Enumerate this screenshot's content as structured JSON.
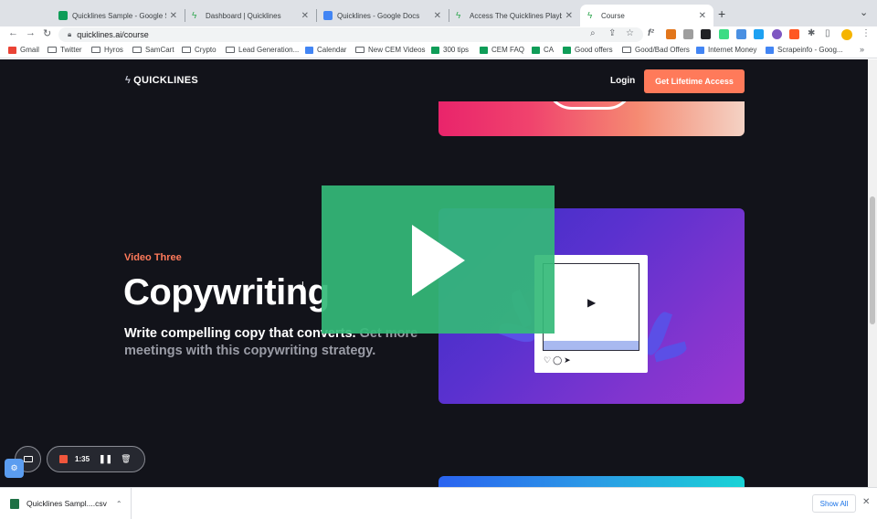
{
  "browser": {
    "tabs": [
      {
        "title": "Quicklines Sample - Google Sh",
        "favicon_color": "#0f9d58"
      },
      {
        "title": "Dashboard | Quicklines",
        "favicon_color": "#34a853"
      },
      {
        "title": "Quicklines - Google Docs",
        "favicon_color": "#4285f4"
      },
      {
        "title": "Access The Quicklines Playboo",
        "favicon_color": "#34a853"
      },
      {
        "title": "Course",
        "favicon_color": "#34a853",
        "active": true
      }
    ],
    "new_tab": "+",
    "tab_menu": "⌄",
    "url": "quicklines.ai/course",
    "bookmarks": [
      {
        "label": "Gmail",
        "icon": "gmail-icon"
      },
      {
        "label": "Twitter",
        "icon": "folder-icon"
      },
      {
        "label": "Hyros",
        "icon": "folder-icon"
      },
      {
        "label": "SamCart",
        "icon": "folder-icon"
      },
      {
        "label": "Crypto",
        "icon": "folder-icon"
      },
      {
        "label": "Lead Generation...",
        "icon": "folder-icon"
      },
      {
        "label": "Calendar",
        "icon": "calendar-icon"
      },
      {
        "label": "New CEM Videos",
        "icon": "folder-icon"
      },
      {
        "label": "300 tips",
        "icon": "sheets-icon"
      },
      {
        "label": "CEM FAQ",
        "icon": "sheets-icon"
      },
      {
        "label": "CA",
        "icon": "sheets-icon"
      },
      {
        "label": "Good offers",
        "icon": "sheets-icon"
      },
      {
        "label": "Good/Bad Offers",
        "icon": "folder-icon"
      },
      {
        "label": "Internet Money",
        "icon": "docs-icon"
      },
      {
        "label": "Scrapeinfo - Goog...",
        "icon": "docs-icon"
      }
    ],
    "bookmarks_more": "»"
  },
  "site": {
    "logo": "QUICKLINES",
    "login": "Login",
    "cta": "Get Lifetime Access",
    "eyebrow": "Video Three",
    "headline": "Copywriting",
    "sub_bright": "Write compelling copy that converts.",
    "sub_dim": " Get more meetings with this copywriting strategy."
  },
  "recorder": {
    "time": "1:35"
  },
  "downloads": {
    "file": "Quicklines Sampl....csv",
    "show_all": "Show All"
  },
  "colors": {
    "page_bg": "#12131a",
    "accent": "#ff7a5a",
    "play_overlay": "#34ba78"
  }
}
